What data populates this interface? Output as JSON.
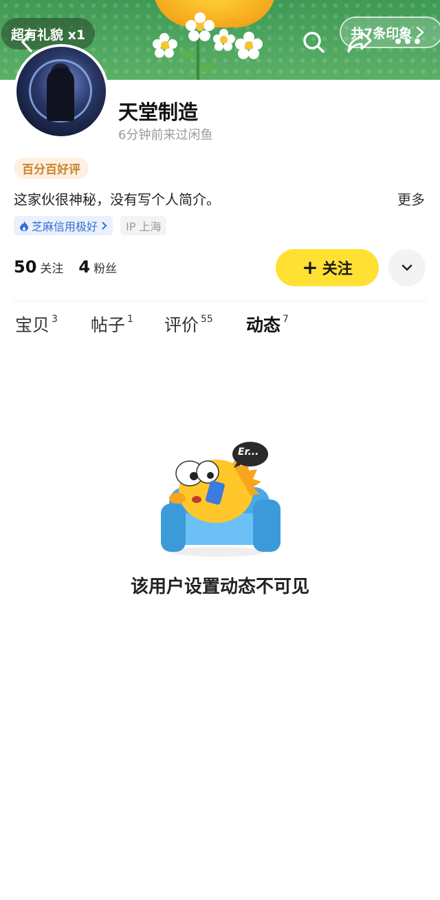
{
  "header": {
    "left_badge": "超有礼貌 x1",
    "right_badge": "共7条印象",
    "icons": [
      "back-icon",
      "search-icon",
      "share-icon",
      "more-icon"
    ]
  },
  "profile": {
    "name": "天堂制造",
    "last_seen": "6分钟前来过闲鱼",
    "rating_badge": "百分百好评",
    "bio": "这家伙很神秘，没有写个人简介。",
    "more_label": "更多",
    "credit_tag": "芝麻信用极好",
    "ip_tag": "IP 上海"
  },
  "stats": {
    "following_count": "50",
    "following_label": "关注",
    "followers_count": "4",
    "followers_label": "粉丝"
  },
  "actions": {
    "follow_label": "关注",
    "follow_prefix": "+"
  },
  "tabs": [
    {
      "label": "宝贝",
      "count": "3"
    },
    {
      "label": "帖子",
      "count": "1"
    },
    {
      "label": "评价",
      "count": "55"
    },
    {
      "label": "动态",
      "count": "7",
      "active": true
    }
  ],
  "empty_state": {
    "bubble_text": "Er...",
    "message": "该用户设置动态不可见"
  },
  "colors": {
    "accent_yellow": "#ffe033",
    "banner_green": "#4aa05a",
    "credit_blue": "#2f6fd6",
    "rating_orange": "#c8842a"
  }
}
